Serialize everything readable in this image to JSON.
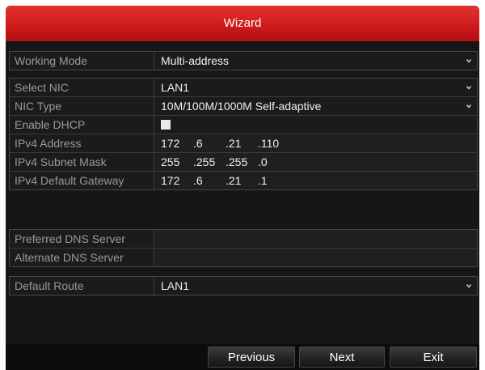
{
  "window": {
    "title": "Wizard"
  },
  "working_mode": {
    "label": "Working Mode",
    "value": "Multi-address"
  },
  "network": {
    "select_nic": {
      "label": "Select NIC",
      "value": "LAN1"
    },
    "nic_type": {
      "label": "NIC Type",
      "value": "10M/100M/1000M Self-adaptive"
    },
    "enable_dhcp": {
      "label": "Enable DHCP",
      "checked": false
    },
    "ipv4_address": {
      "label": "IPv4 Address",
      "octets": [
        "172",
        ".6",
        ".21",
        ".110"
      ]
    },
    "subnet_mask": {
      "label": "IPv4 Subnet Mask",
      "octets": [
        "255",
        ".255",
        ".255",
        ".0"
      ]
    },
    "default_gateway": {
      "label": "IPv4 Default Gateway",
      "octets": [
        "172",
        ".6",
        ".21",
        ".1"
      ]
    }
  },
  "dns": {
    "preferred": {
      "label": "Preferred DNS Server",
      "value": ""
    },
    "alternate": {
      "label": "Alternate DNS Server",
      "value": ""
    }
  },
  "route": {
    "label": "Default Route",
    "value": "LAN1"
  },
  "buttons": {
    "previous": "Previous",
    "next": "Next",
    "exit": "Exit"
  },
  "icons": {
    "dropdown": "chevron-down-icon"
  },
  "colors": {
    "title_red": "#cf1b1d",
    "panel_bg": "#1a1a1a"
  }
}
